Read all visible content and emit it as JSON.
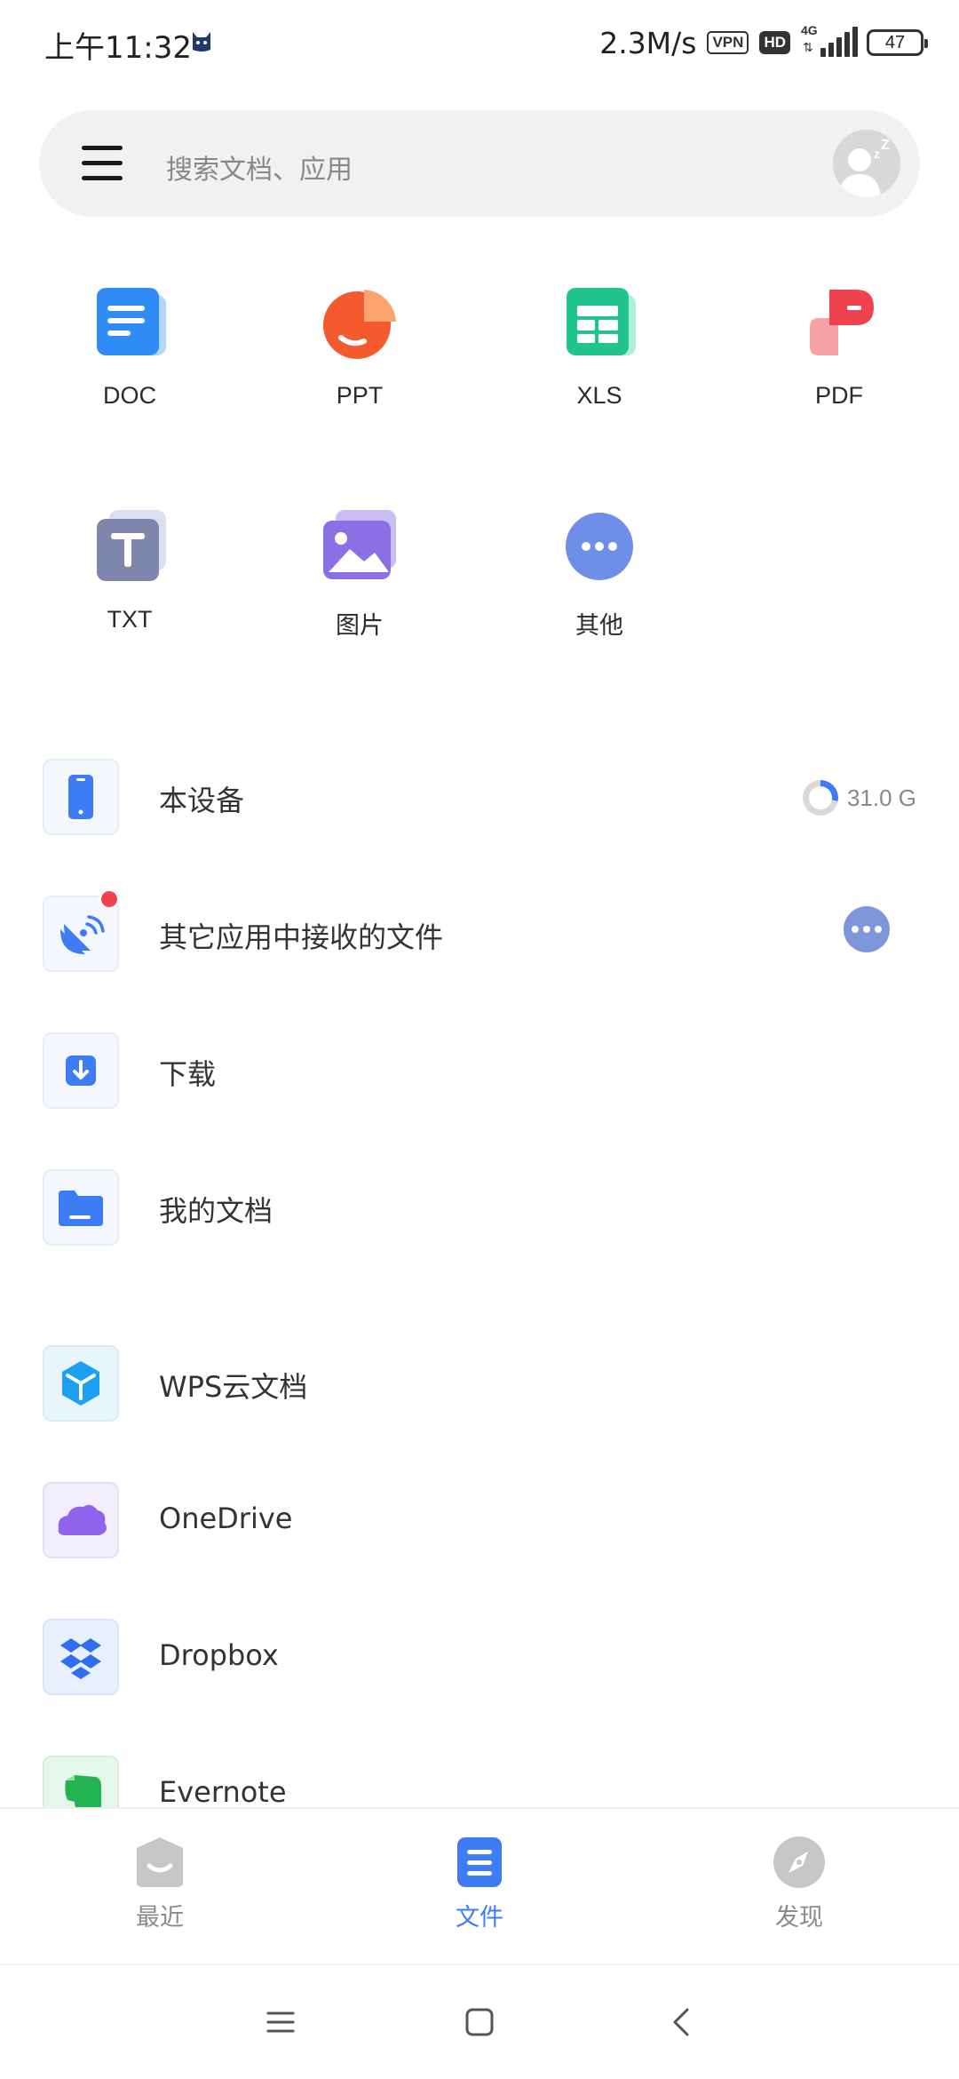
{
  "status_bar": {
    "time": "上午11:32",
    "net_speed": "2.3M/s",
    "vpn": "VPN",
    "hd": "HD",
    "network": "4G",
    "battery": "47"
  },
  "search": {
    "placeholder": "搜索文档、应用"
  },
  "categories": [
    {
      "label": "DOC",
      "icon": "doc-icon",
      "color": "#2f8cf7"
    },
    {
      "label": "PPT",
      "icon": "ppt-icon",
      "color": "#f45a2d"
    },
    {
      "label": "XLS",
      "icon": "xls-icon",
      "color": "#21c48d"
    },
    {
      "label": "PDF",
      "icon": "pdf-icon",
      "color": "#f0414f"
    },
    {
      "label": "TXT",
      "icon": "txt-icon",
      "color": "#7e86ad"
    },
    {
      "label": "图片",
      "icon": "image-icon",
      "color": "#8b6fe5"
    },
    {
      "label": "其他",
      "icon": "more-icon",
      "color": "#6f8ee8"
    }
  ],
  "locations": [
    {
      "label": "本设备",
      "icon": "phone-icon",
      "storage": "31.0 G"
    },
    {
      "label": "其它应用中接收的文件",
      "icon": "satellite-icon"
    },
    {
      "label": "下载",
      "icon": "download-icon"
    },
    {
      "label": "我的文档",
      "icon": "folder-icon"
    }
  ],
  "cloud": [
    {
      "label": "WPS云文档",
      "icon": "wps-cloud-icon"
    },
    {
      "label": "OneDrive",
      "icon": "onedrive-icon"
    },
    {
      "label": "Dropbox",
      "icon": "dropbox-icon"
    },
    {
      "label": "Evernote",
      "icon": "evernote-icon"
    }
  ],
  "bottom_nav": [
    {
      "label": "最近",
      "icon": "recent-icon"
    },
    {
      "label": "文件",
      "icon": "file-icon",
      "active": true
    },
    {
      "label": "发现",
      "icon": "compass-icon"
    }
  ],
  "colors": {
    "accent": "#3d7cf5",
    "badge_red": "#f1414a"
  }
}
